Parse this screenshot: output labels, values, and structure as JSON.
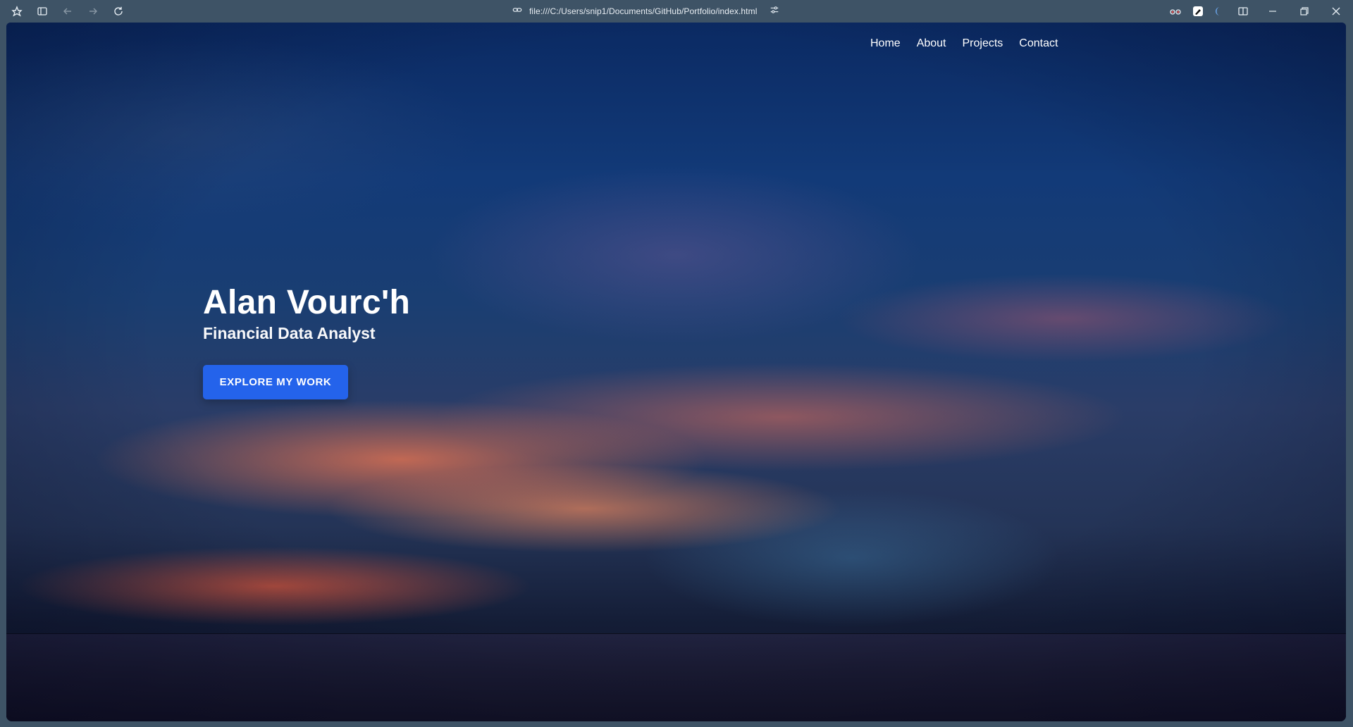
{
  "browser": {
    "url": "file:///C:/Users/snip1/Documents/GitHub/Portfolio/index.html",
    "icons": {
      "app": "app-logo-icon",
      "sidebar": "sidebar-toggle-icon",
      "back": "back-arrow-icon",
      "forward": "forward-arrow-icon",
      "reload": "reload-icon",
      "link": "link-icon",
      "site_settings": "site-settings-icon",
      "extension1": "extension-glasses-icon",
      "extension2": "extension-pen-icon",
      "extension3": "extension-moon-icon",
      "split_view": "split-view-icon",
      "minimize": "minimize-icon",
      "restore": "restore-icon",
      "close": "close-icon"
    },
    "colors": {
      "chrome_bg": "#3e5366"
    }
  },
  "site": {
    "nav": {
      "home": "Home",
      "about": "About",
      "projects": "Projects",
      "contact": "Contact"
    },
    "hero": {
      "name": "Alan Vourc'h",
      "title": "Financial Data Analyst",
      "cta": "EXPLORE MY WORK"
    },
    "colors": {
      "cta_bg": "#2463eb",
      "text": "#ffffff"
    }
  }
}
